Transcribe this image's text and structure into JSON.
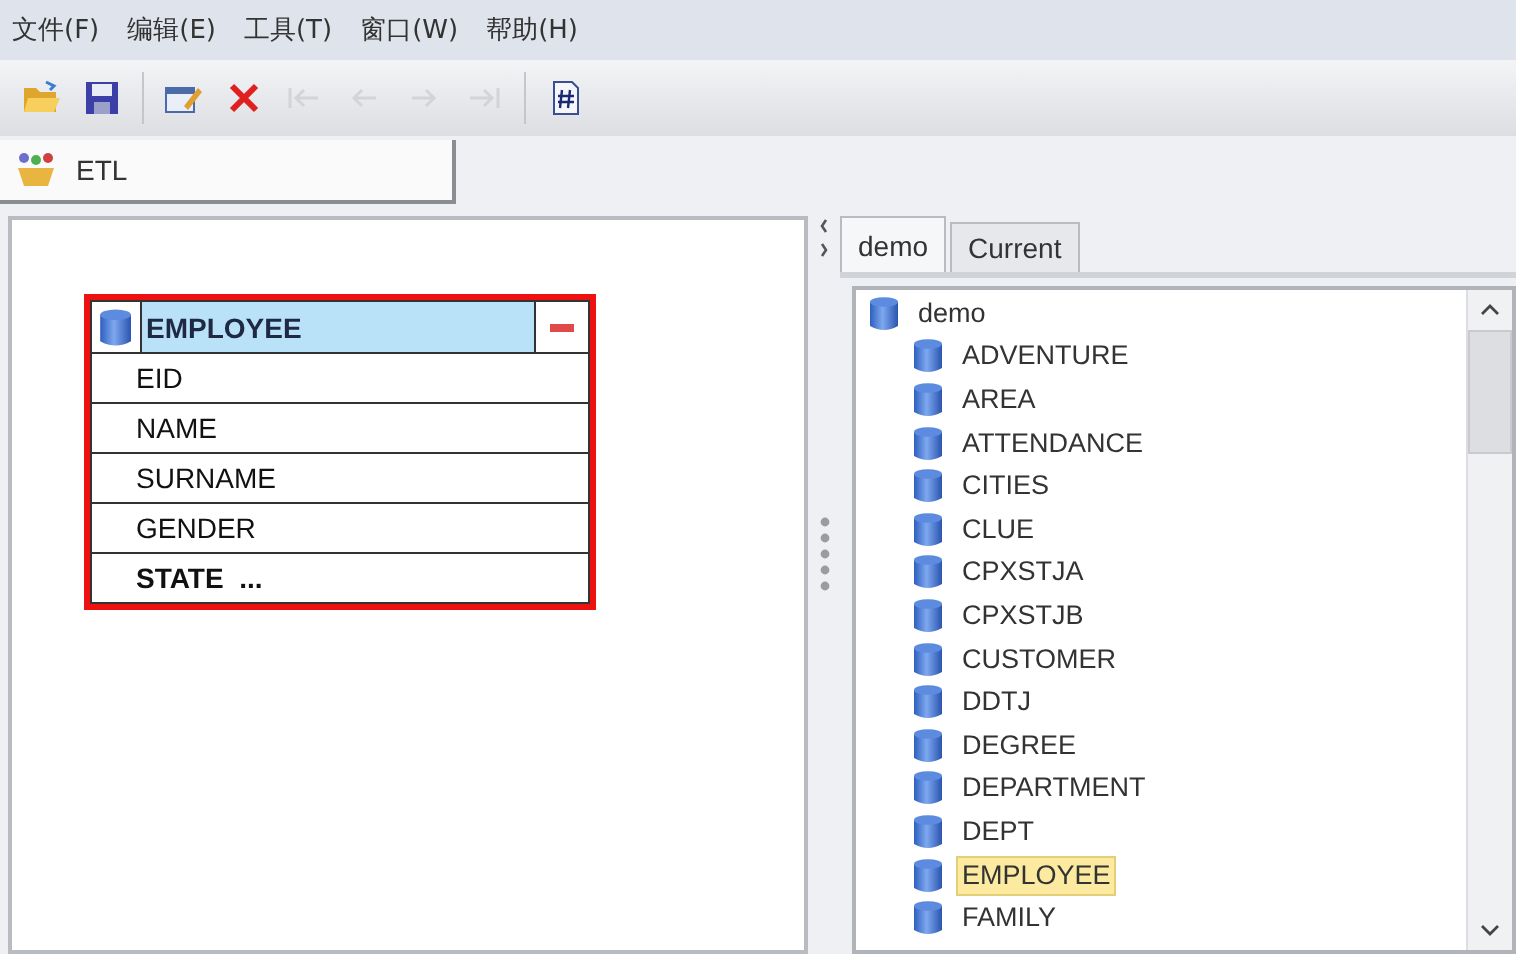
{
  "menu": [
    {
      "label": "文件(F)"
    },
    {
      "label": "编辑(E)"
    },
    {
      "label": "工具(T)"
    },
    {
      "label": "窗口(W)"
    },
    {
      "label": "帮助(H)"
    }
  ],
  "toolbar": [
    {
      "kind": "open",
      "disabled": false
    },
    {
      "kind": "save",
      "disabled": false
    },
    {
      "kind": "separator"
    },
    {
      "kind": "edit",
      "disabled": false
    },
    {
      "kind": "delete",
      "disabled": false
    },
    {
      "kind": "first",
      "disabled": true
    },
    {
      "kind": "prev",
      "disabled": true
    },
    {
      "kind": "next",
      "disabled": true
    },
    {
      "kind": "last",
      "disabled": true
    },
    {
      "kind": "separator"
    },
    {
      "kind": "script",
      "disabled": false
    }
  ],
  "document_tab": {
    "label": "ETL"
  },
  "canvas": {
    "table": {
      "name": "EMPLOYEE",
      "fields": [
        {
          "name": "EID",
          "bold": false
        },
        {
          "name": "NAME",
          "bold": false
        },
        {
          "name": "SURNAME",
          "bold": false
        },
        {
          "name": "GENDER",
          "bold": false
        },
        {
          "name": "STATE  ...",
          "bold": true
        }
      ]
    }
  },
  "tabs": [
    {
      "label": "demo",
      "selected": true
    },
    {
      "label": "Current",
      "selected": false
    }
  ],
  "tree": {
    "label": "demo",
    "children": [
      {
        "label": "ADVENTURE",
        "selected": false
      },
      {
        "label": "AREA",
        "selected": false
      },
      {
        "label": "ATTENDANCE",
        "selected": false
      },
      {
        "label": "CITIES",
        "selected": false
      },
      {
        "label": "CLUE",
        "selected": false
      },
      {
        "label": "CPXSTJA",
        "selected": false
      },
      {
        "label": "CPXSTJB",
        "selected": false
      },
      {
        "label": "CUSTOMER",
        "selected": false
      },
      {
        "label": "DDTJ",
        "selected": false
      },
      {
        "label": "DEGREE",
        "selected": false
      },
      {
        "label": "DEPARTMENT",
        "selected": false
      },
      {
        "label": "DEPT",
        "selected": false
      },
      {
        "label": "EMPLOYEE",
        "selected": true
      },
      {
        "label": "FAMILY",
        "selected": false
      }
    ]
  }
}
